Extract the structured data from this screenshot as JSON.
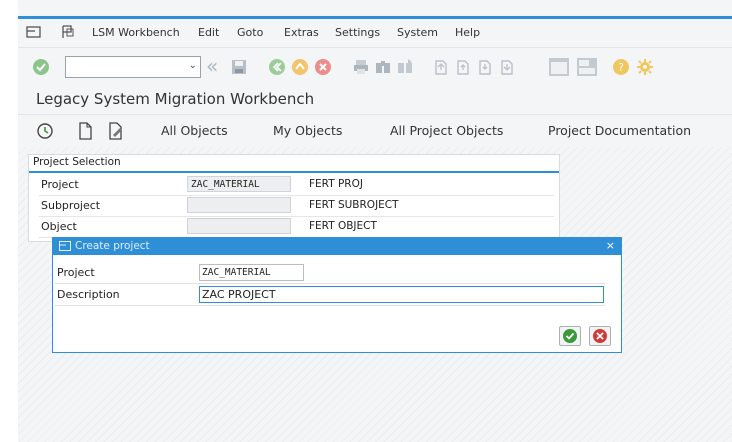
{
  "menu": {
    "items": [
      "LSM Workbench",
      "Edit",
      "Goto",
      "Extras",
      "Settings",
      "System",
      "Help"
    ]
  },
  "toolbar": {
    "command_value": ""
  },
  "title": "Legacy System Migration Workbench",
  "app_toolbar": {
    "items": [
      "All Objects",
      "My Objects",
      "All Project Objects",
      "Project Documentation"
    ]
  },
  "selection": {
    "header": "Project Selection",
    "rows": [
      {
        "label": "Project",
        "value": "ZAC_MATERIAL",
        "description": "FERT PROJ"
      },
      {
        "label": "Subproject",
        "value": "",
        "description": "FERT SUBROJECT"
      },
      {
        "label": "Object",
        "value": "",
        "description": "FERT OBJECT"
      }
    ]
  },
  "dialog": {
    "title": "Create project",
    "fields": [
      {
        "label": "Project",
        "value": "ZAC_MATERIAL"
      },
      {
        "label": "Description",
        "value": "ZAC PROJECT"
      }
    ]
  },
  "colors": {
    "accent": "#2f8fd6",
    "ok": "#3a9a3a",
    "cancel": "#d23a3a"
  }
}
